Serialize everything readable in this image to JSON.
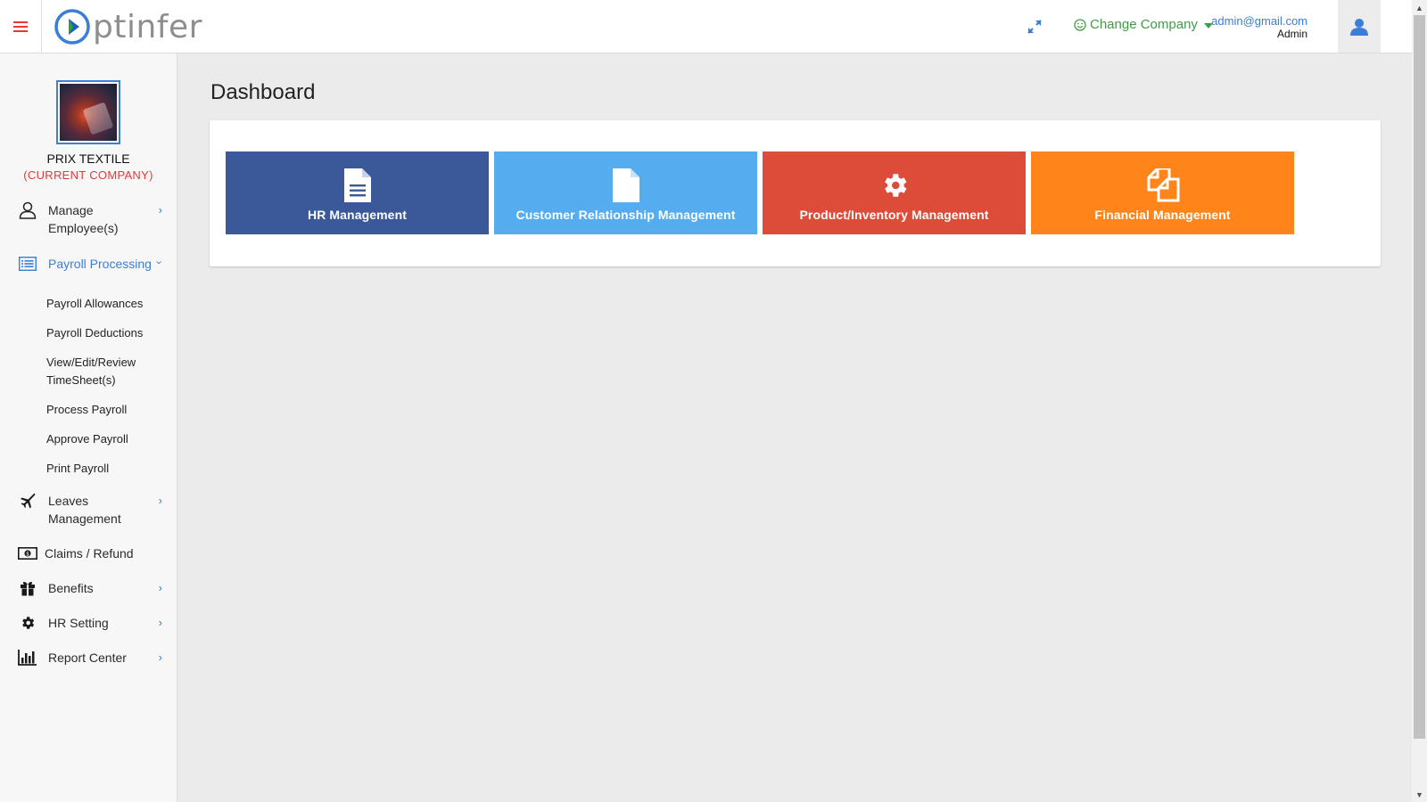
{
  "header": {
    "logo_text": "ptinfer",
    "change_company_label": "Change Company",
    "user_email": "admin@gmail.com",
    "user_role": "Admin"
  },
  "sidebar": {
    "company_name": "PRIX TEXTILE",
    "company_status": "(CURRENT COMPANY)",
    "items": [
      {
        "label": "Manage Employee(s)",
        "icon": "user-outline-icon"
      },
      {
        "label": "Payroll Processing",
        "icon": "list-icon"
      },
      {
        "label": "Leaves Management",
        "icon": "plane-icon"
      },
      {
        "label": "Claims / Refund",
        "icon": "money-icon"
      },
      {
        "label": "Benefits",
        "icon": "gift-icon"
      },
      {
        "label": "HR Setting",
        "icon": "gear-icon"
      },
      {
        "label": "Report Center",
        "icon": "bar-chart-icon"
      }
    ],
    "payroll_sub": [
      "Payroll Allowances",
      "Payroll Deductions",
      "View/Edit/Review TimeSheet(s)",
      "Process Payroll",
      "Approve Payroll",
      "Print Payroll"
    ]
  },
  "main": {
    "title": "Dashboard",
    "tiles": [
      {
        "label": "HR Management",
        "icon": "document-icon",
        "color": "#3b5998"
      },
      {
        "label": "Customer Relationship Management",
        "icon": "file-icon",
        "color": "#55acee"
      },
      {
        "label": "Product/Inventory Management",
        "icon": "gear-icon",
        "color": "#dd4b39"
      },
      {
        "label": "Financial Management",
        "icon": "copy-icon",
        "color": "#ff851b"
      }
    ]
  },
  "colors": {
    "accent_blue": "#3b7dd8",
    "hamburger_red": "#e53935",
    "green": "#3e9d47",
    "current_company_red": "#e53935"
  }
}
